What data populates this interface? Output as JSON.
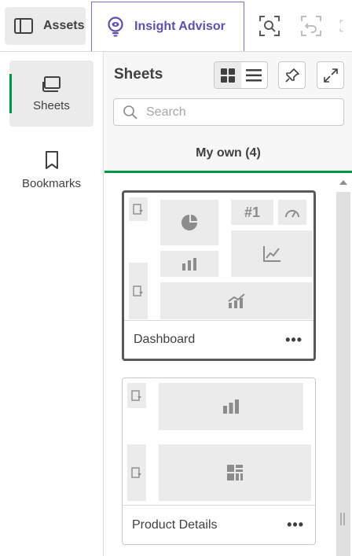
{
  "toolbar": {
    "assets_label": "Assets",
    "insight_label": "Insight Advisor",
    "accent": "#5c4fb0"
  },
  "nav": {
    "items": [
      {
        "label": "Sheets",
        "icon": "sheet-icon",
        "active": true
      },
      {
        "label": "Bookmarks",
        "icon": "bookmark-icon",
        "active": false
      }
    ],
    "active_color": "#009845"
  },
  "panel": {
    "title": "Sheets",
    "search_placeholder": "Search",
    "tab_label": "My own (4)",
    "sheets": [
      {
        "name": "Dashboard",
        "more": "•••",
        "kpi_text": "#1",
        "selected": true
      },
      {
        "name": "Product Details",
        "more": "•••",
        "selected": false
      }
    ]
  }
}
